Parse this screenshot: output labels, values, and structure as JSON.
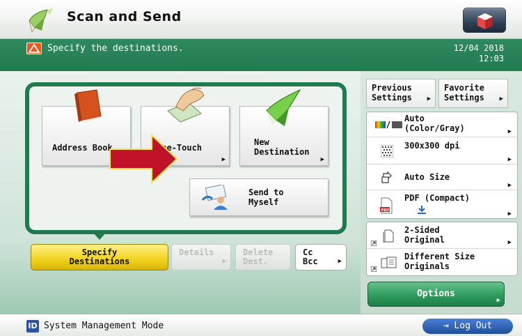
{
  "header": {
    "title": "Scan and Send"
  },
  "message_bar": {
    "message": "Specify the destinations.",
    "date": "12/04 2018",
    "time": "12:03"
  },
  "destinations": {
    "address_book": "Address Book",
    "one_touch": "One-Touch",
    "new_destination_line1": "New",
    "new_destination_line2": "Destination",
    "send_to_myself_line1": "Send to",
    "send_to_myself_line2": "Myself"
  },
  "tabs": {
    "specify_line1": "Specify",
    "specify_line2": "Destinations",
    "details": "Details",
    "delete_line1": "Delete",
    "delete_line2": "Dest.",
    "cc": "Cc",
    "bcc": "Bcc"
  },
  "settings": {
    "previous_line1": "Previous",
    "previous_line2": "Settings",
    "favorite_line1": "Favorite",
    "favorite_line2": "Settings",
    "color_line1": "Auto",
    "color_line2": "(Color/Gray)",
    "resolution": "300x300 dpi",
    "size": "Auto Size",
    "format": "PDF (Compact)",
    "sides_line1": "2-Sided",
    "sides_line2": "Original",
    "diff_line1": "Different Size",
    "diff_line2": "Originals",
    "options": "Options"
  },
  "status": {
    "mode": "System Management Mode",
    "logout": "Log Out",
    "id_icon": "ID"
  },
  "colors": {
    "brand_green": "#237a4f",
    "selected_yellow": "#f1d21c",
    "arrow_red": "#c0132a",
    "logout_blue": "#1e4f9e"
  }
}
